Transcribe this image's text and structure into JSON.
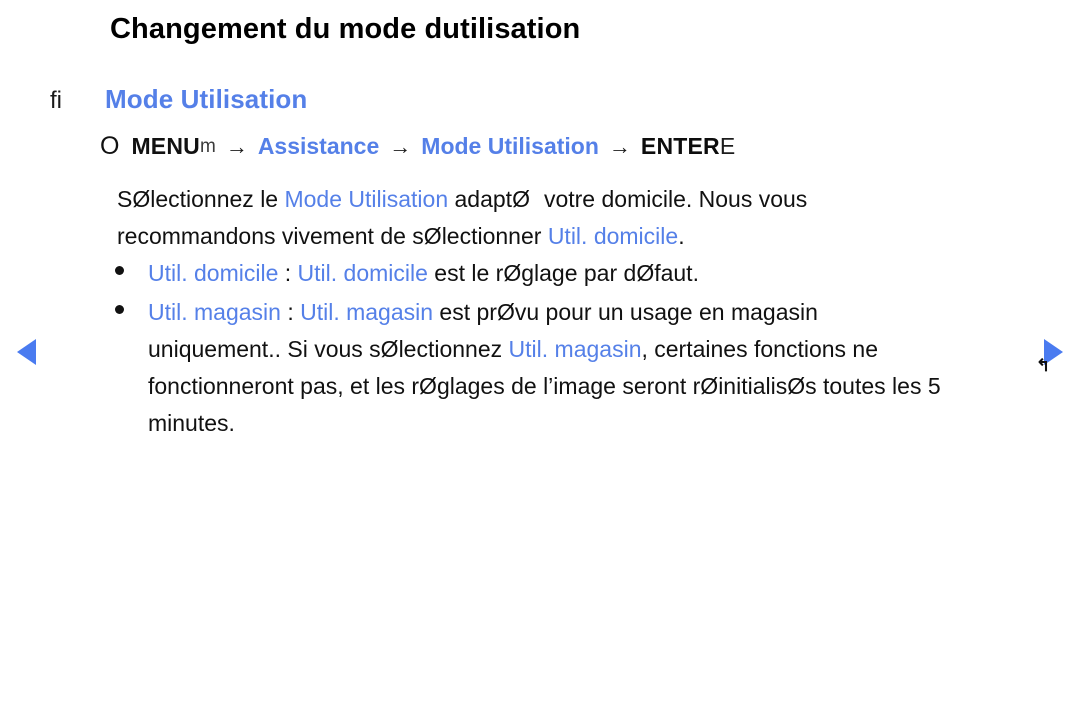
{
  "page": {
    "title": "Changement du mode dutilisation"
  },
  "section": {
    "marker": "fi",
    "title": "Mode Utilisation"
  },
  "menu_path": {
    "circle_icon": "O",
    "menu_label": "MENU",
    "menu_label_sub": "m",
    "arrow": "→",
    "step_assistance": "Assistance",
    "step_mode_utilisation": "Mode Utilisation",
    "enter_label": "ENTER",
    "enter_tail": "E"
  },
  "paragraph": {
    "line1_a": "SØlectionnez le ",
    "line1_blue": "Mode Utilisation",
    "line1_b": " adaptØ",
    "line1_c": "votre domicile. Nous vous",
    "line2_a": "recommandons vivement de sØlectionner ",
    "line2_blue": "Util. domicile",
    "line2_b": "."
  },
  "bullets": [
    {
      "lines": [
        {
          "parts": [
            {
              "text": "Util. domicile",
              "color": "blue"
            },
            {
              "text": " : ",
              "color": "black"
            },
            {
              "text": "Util. domicile",
              "color": "blue"
            },
            {
              "text": " est le rØglage par dØfaut.",
              "color": "black"
            }
          ]
        }
      ]
    },
    {
      "lines": [
        {
          "parts": [
            {
              "text": "Util. magasin",
              "color": "blue"
            },
            {
              "text": " : ",
              "color": "black"
            },
            {
              "text": "Util. magasin",
              "color": "blue"
            },
            {
              "text": " est prØvu pour un usage en magasin",
              "color": "black"
            }
          ]
        },
        {
          "parts": [
            {
              "text": "uniquement.. Si vous sØlectionnez ",
              "color": "black"
            },
            {
              "text": "Util. magasin",
              "color": "blue"
            },
            {
              "text": ", certaines fonctions ne",
              "color": "black"
            }
          ]
        },
        {
          "parts": [
            {
              "text": "fonctionneront pas, et les rØglages de l’image seront rØinitialisØs toutes les 5",
              "color": "black"
            }
          ]
        },
        {
          "parts": [
            {
              "text": "minutes.",
              "color": "black"
            }
          ]
        }
      ]
    }
  ],
  "navigation": {
    "prev_arrow": "◀",
    "next_arrow": "▶",
    "cursor": "↰"
  },
  "colors": {
    "accent_blue": "#5580e8",
    "arrow_blue": "#4a7bf0",
    "text_black": "#111111",
    "background": "#ffffff"
  }
}
